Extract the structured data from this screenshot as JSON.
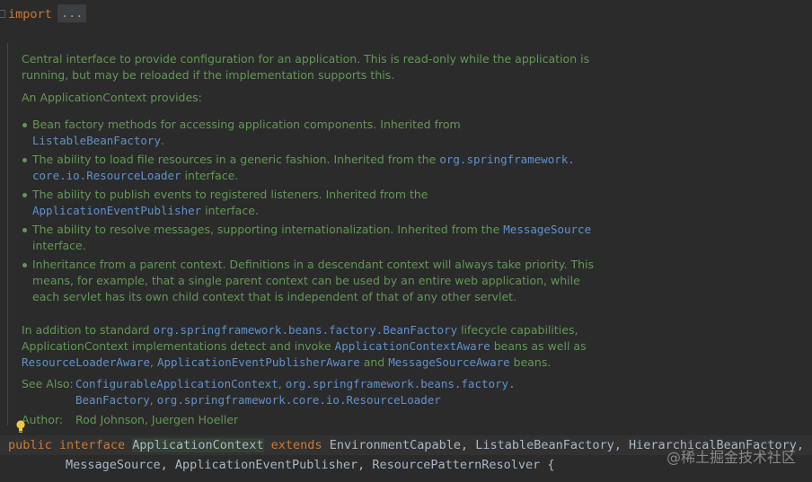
{
  "import_line": {
    "keyword": "import",
    "folded": "..."
  },
  "doc": {
    "intro_1": "Central interface to provide configuration for an application. This is read-only while the application is",
    "intro_2": "running, but may be reloaded if the implementation supports this.",
    "provides": "An ApplicationContext provides:",
    "bullets": [
      {
        "l1": "Bean factory methods for accessing application components. Inherited from",
        "code": "ListableBeanFactory",
        "tail": "."
      },
      {
        "l1_text": "The ability to load file resources in a generic fashion. Inherited from the",
        "l1_code": "org.springframework.",
        "l2_code": "core.io.ResourceLoader",
        "l2_tail": " interface."
      },
      {
        "l1": "The ability to publish events to registered listeners. Inherited from the",
        "code": "ApplicationEventPublisher",
        "tail": " interface."
      },
      {
        "l1_text": "The ability to resolve messages, supporting internationalization. Inherited from the",
        "l1_code": "MessageSource",
        "l2_tail": "interface."
      },
      {
        "l1": "Inheritance from a parent context. Definitions in a descendant context will always take priority. This",
        "l2": "means, for example, that a single parent context can be used by an entire web application, while",
        "l3": "each servlet has its own child context that is independent of that of any other servlet."
      }
    ],
    "additional": {
      "a1_text": "In addition to standard ",
      "a1_code": "org.springframework.beans.factory.BeanFactory",
      "a1_tail": " lifecycle capabilities,",
      "a2_text": "ApplicationContext implementations detect and invoke ",
      "a2_code": "ApplicationContextAware",
      "a2_tail": " beans as well as",
      "a3_code1": "ResourceLoaderAware",
      "a3_sep1": ", ",
      "a3_code2": "ApplicationEventPublisherAware",
      "a3_and": " and ",
      "a3_code3": "MessageSourceAware",
      "a3_tail": " beans."
    },
    "see_also": {
      "label": "See Also:",
      "link1": "ConfigurableApplicationContext",
      "sep": ", ",
      "link2": "org.springframework.beans.factory.",
      "link2b": "BeanFactory",
      "link3": "org.springframework.core.io.ResourceLoader"
    },
    "author": {
      "label": "Author:",
      "value": "Rod Johnson, Juergen Hoeller"
    }
  },
  "declaration": {
    "public": "public",
    "interface": "interface",
    "name": "ApplicationContext",
    "extends": "extends",
    "line1_types": "EnvironmentCapable, ListableBeanFactory, HierarchicalBeanFactory,",
    "line2_types": "MessageSource, ApplicationEventPublisher, ResourcePatternResolver {"
  },
  "watermark": "@稀土掘金技术社区",
  "colors": {
    "keyword": "#cc7832",
    "doc_text": "#629755",
    "doc_code": "#5f91cc",
    "identifier": "#a9b7c6",
    "background": "#2b2b2b"
  }
}
